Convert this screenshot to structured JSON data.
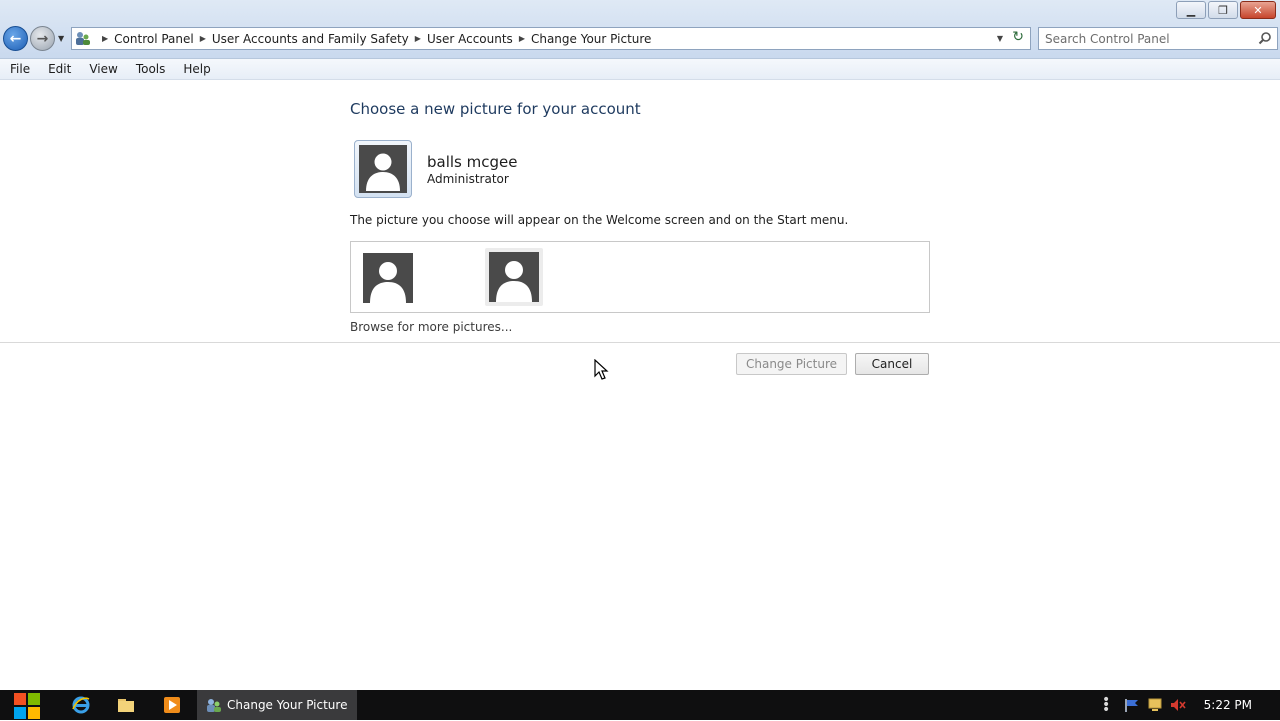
{
  "window": {
    "caption_buttons": [
      "minimize-icon",
      "restore-icon",
      "close-icon"
    ]
  },
  "navigation": {
    "back_icon": "back-arrow-icon",
    "forward_icon": "forward-arrow-icon",
    "breadcrumbs": [
      "Control Panel",
      "User Accounts and Family Safety",
      "User Accounts",
      "Change Your Picture"
    ],
    "search": {
      "placeholder": "Search Control Panel",
      "value": ""
    }
  },
  "menu": [
    "File",
    "Edit",
    "View",
    "Tools",
    "Help"
  ],
  "content": {
    "heading": "Choose a new picture for your account",
    "user": {
      "name": "balls mcgee",
      "role": "Administrator"
    },
    "description": "The picture you choose will appear on the Welcome screen and on the Start menu.",
    "pictures": [
      {
        "icon": "user-silhouette-icon",
        "selected": false
      },
      {
        "icon": "user-silhouette-icon",
        "selected": true
      }
    ],
    "browse_link": "Browse for more pictures...",
    "buttons": {
      "change_picture": "Change Picture",
      "cancel": "Cancel"
    }
  },
  "taskbar": {
    "pinned": [
      "internet-explorer-icon",
      "explorer-folder-icon",
      "media-player-icon"
    ],
    "active_task": "Change Your Picture",
    "tray_icons": [
      "action-center-flag-icon",
      "network-icon",
      "volume-muted-icon"
    ],
    "clock": "5:22 PM"
  },
  "colors": {
    "heading": "#1e3a5f",
    "taskbar": "#0f0f10",
    "close_button": "#c7452c"
  }
}
